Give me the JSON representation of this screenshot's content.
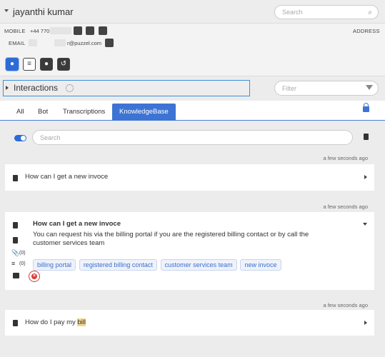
{
  "header": {
    "name": "jayanthi kumar",
    "search_placeholder": "Search"
  },
  "contact": {
    "mobile_label": "MOBILE",
    "mobile_value": "+44 770",
    "email_label": "EMAIL",
    "email_value": "r@puzzel.com",
    "address_label": "ADDRESS"
  },
  "interactions": {
    "title": "Interactions",
    "filter_placeholder": "Filter"
  },
  "tabs": [
    {
      "label": "All"
    },
    {
      "label": "Bot"
    },
    {
      "label": "Transcriptions"
    },
    {
      "label": "KnowledgeBase"
    }
  ],
  "kb": {
    "search_placeholder": "Search",
    "items": [
      {
        "timestamp": "a few seconds ago",
        "question": "How can I get a new invoce"
      },
      {
        "timestamp": "a few seconds ago",
        "question": "How can I get a new invoce",
        "answer": "You can request his via the billing portal if you are the registered billing contact or by call the customer services team",
        "attachments_count": "(0)",
        "list_count": "(0)",
        "tags": [
          "billing portal",
          "registered billing contact",
          "customer services team",
          "new invoce"
        ]
      },
      {
        "timestamp": "a few seconds ago",
        "question_prefix": "How do I pay my ",
        "question_highlight": "bill"
      }
    ]
  },
  "colors": {
    "accent": "#3d74d4",
    "highlight": "#f7d48a",
    "close": "#d93a3a"
  }
}
